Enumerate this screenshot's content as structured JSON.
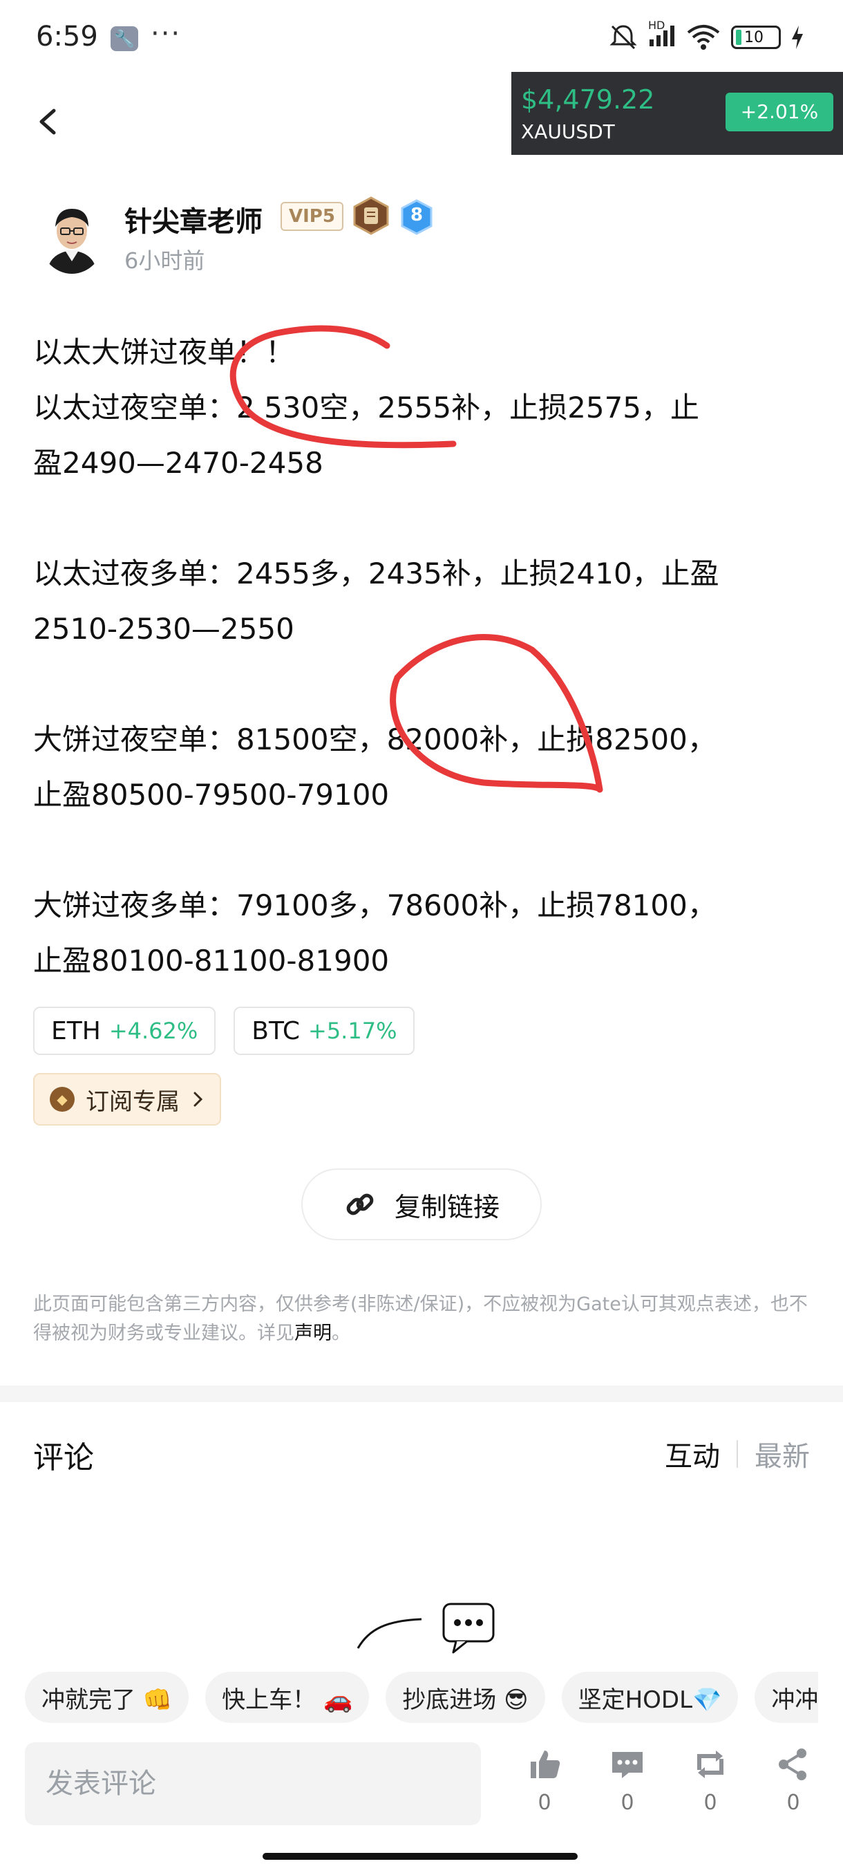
{
  "status_bar": {
    "time": "6:59",
    "wrench": "🔧",
    "dots": "···",
    "network": "HD",
    "battery": "10",
    "icons": [
      "silent-icon",
      "signal-icon",
      "wifi-icon",
      "battery-icon",
      "charging-icon"
    ]
  },
  "ticker": {
    "price": "$4,479.22",
    "symbol": "XAUUSDT",
    "change": "+2.01%"
  },
  "author": {
    "name": "针尖章老师",
    "vip": "VIP5",
    "level": "8",
    "time_ago": "6小时前"
  },
  "post": {
    "lines": [
      "以太大饼过夜单！！",
      "以太过夜空单：2 530空，2555补，止损2575，止",
      "盈2490—2470-2458",
      "以太过夜多单：2455多，2435补，止损2410，止盈",
      "2510-2530—2550",
      "大饼过夜空单：81500空，82000补，止损82500，",
      "止盈80500-79500-79100",
      "大饼过夜多单：79100多，78600补，止损78100，",
      "止盈80100-81100-81900"
    ]
  },
  "tags": [
    {
      "symbol": "ETH",
      "change": "+4.62%"
    },
    {
      "symbol": "BTC",
      "change": "+5.17%"
    }
  ],
  "subscribe": {
    "label": "订阅专属"
  },
  "copy_link": {
    "label": "复制链接"
  },
  "disclaimer": {
    "text": "此页面可能包含第三方内容，仅供参考(非陈述/保证)，不应被视为Gate认可其观点表述，也不得被视为财务或专业建议。详见",
    "link": "声明",
    "end": "。"
  },
  "comments": {
    "title": "评论",
    "sort_active": "互动",
    "sort_inactive": "最新"
  },
  "quick_replies": [
    "冲就完了 👊",
    "快上车！ 🚗",
    "抄底进场 😎",
    "坚定HODL💎",
    "冲冲"
  ],
  "bottom_bar": {
    "placeholder": "发表评论",
    "like_count": "0",
    "comment_count": "0",
    "repost_count": "0",
    "share_count": "0"
  },
  "colors": {
    "green": "#2ebd85",
    "annotation_red": "#e8393a",
    "ticker_bg": "#2f3033"
  }
}
